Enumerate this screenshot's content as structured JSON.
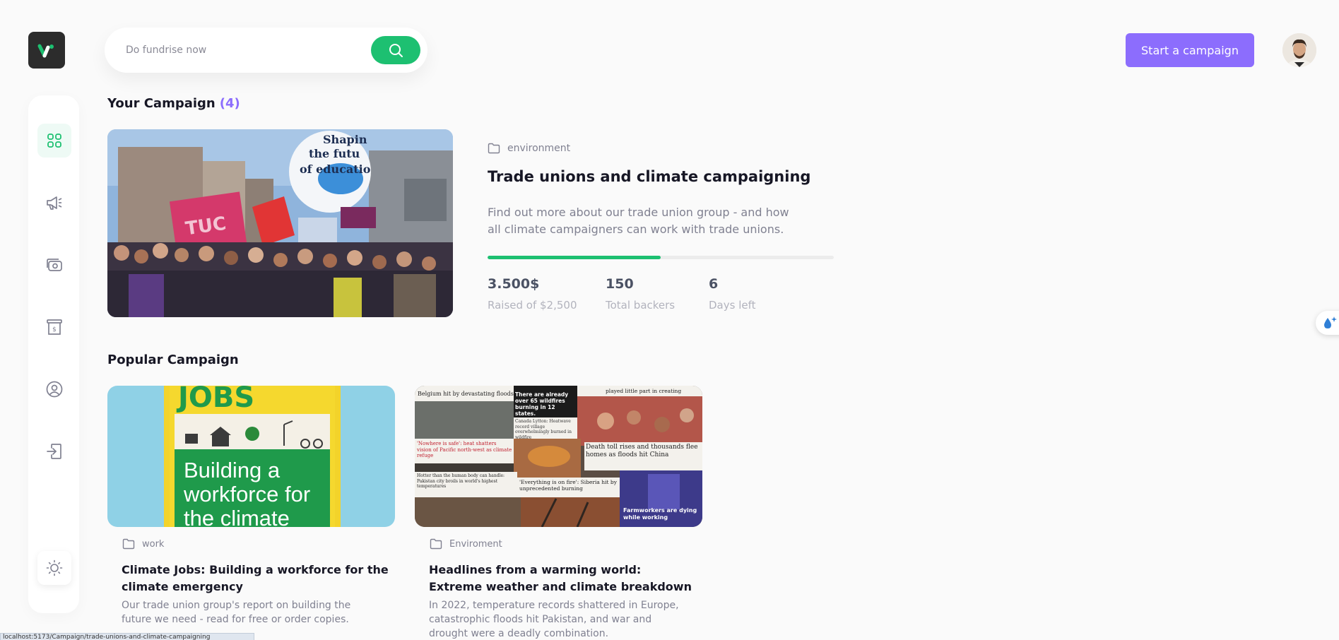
{
  "search": {
    "placeholder": "Do fundrise now"
  },
  "header": {
    "start_campaign_label": "Start a campaign"
  },
  "your_campaign": {
    "title": "Your Campaign",
    "count": "(4)",
    "category": "environment",
    "name": "Trade unions and climate campaigning",
    "description": "Find out more about our trade union group - and how all climate campaigners can work with trade unions.",
    "progress_fraction": 0.5,
    "stats": [
      {
        "value": "3.500$",
        "label": "Raised of $2,500"
      },
      {
        "value": "150",
        "label": "Total backers"
      },
      {
        "value": "6",
        "label": "Days left"
      }
    ]
  },
  "popular": {
    "title": "Popular Campaign",
    "cards": [
      {
        "category": "work",
        "title": "Climate Jobs: Building a workforce for the climate emergency",
        "description": "Our trade union group's report on building the future we need - read for free or order copies.",
        "image_text": [
          "JOBS",
          "Building a",
          "workforce for",
          "the climate"
        ]
      },
      {
        "category": "Enviroment",
        "title": "Headlines from a warming world: Extreme weather and climate breakdown",
        "description": "In 2022, temperature records shattered in Europe, catastrophic floods hit Pakistan, and war and drought were a deadly combination.",
        "image_text": [
          "Belgium hit by devastating floods",
          "There are already over 65 wildfires burning in 12 states.",
          "played little part in creating",
          "'Nowhere is safe': heat shatters vision of Pacific north-west as climate refuge",
          "Canada Lytton: Heatwave record village overwhelmingly burned in wildfire",
          "Death toll rises and thousands flee homes as floods hit China",
          "Hotter than the human body can handle: Pakistan city broils in world's highest temperatures",
          "'Everything is on fire': Siberia hit by unprecedented burning",
          "Farmworkers are dying while working"
        ]
      }
    ]
  },
  "status_bar": {
    "text": "localhost:5173/Campaign/trade-unions-and-climate-campaigning"
  },
  "colors": {
    "primary": "#1dc071",
    "accent": "#8c6dfd",
    "logo_bg": "#2c2c2c"
  },
  "icons": [
    "logo-icon",
    "search-icon",
    "dashboard-icon",
    "campaign-megaphone-icon",
    "payment-icon",
    "withdraw-icon",
    "profile-icon",
    "logout-icon",
    "sun-icon",
    "folder-icon"
  ]
}
